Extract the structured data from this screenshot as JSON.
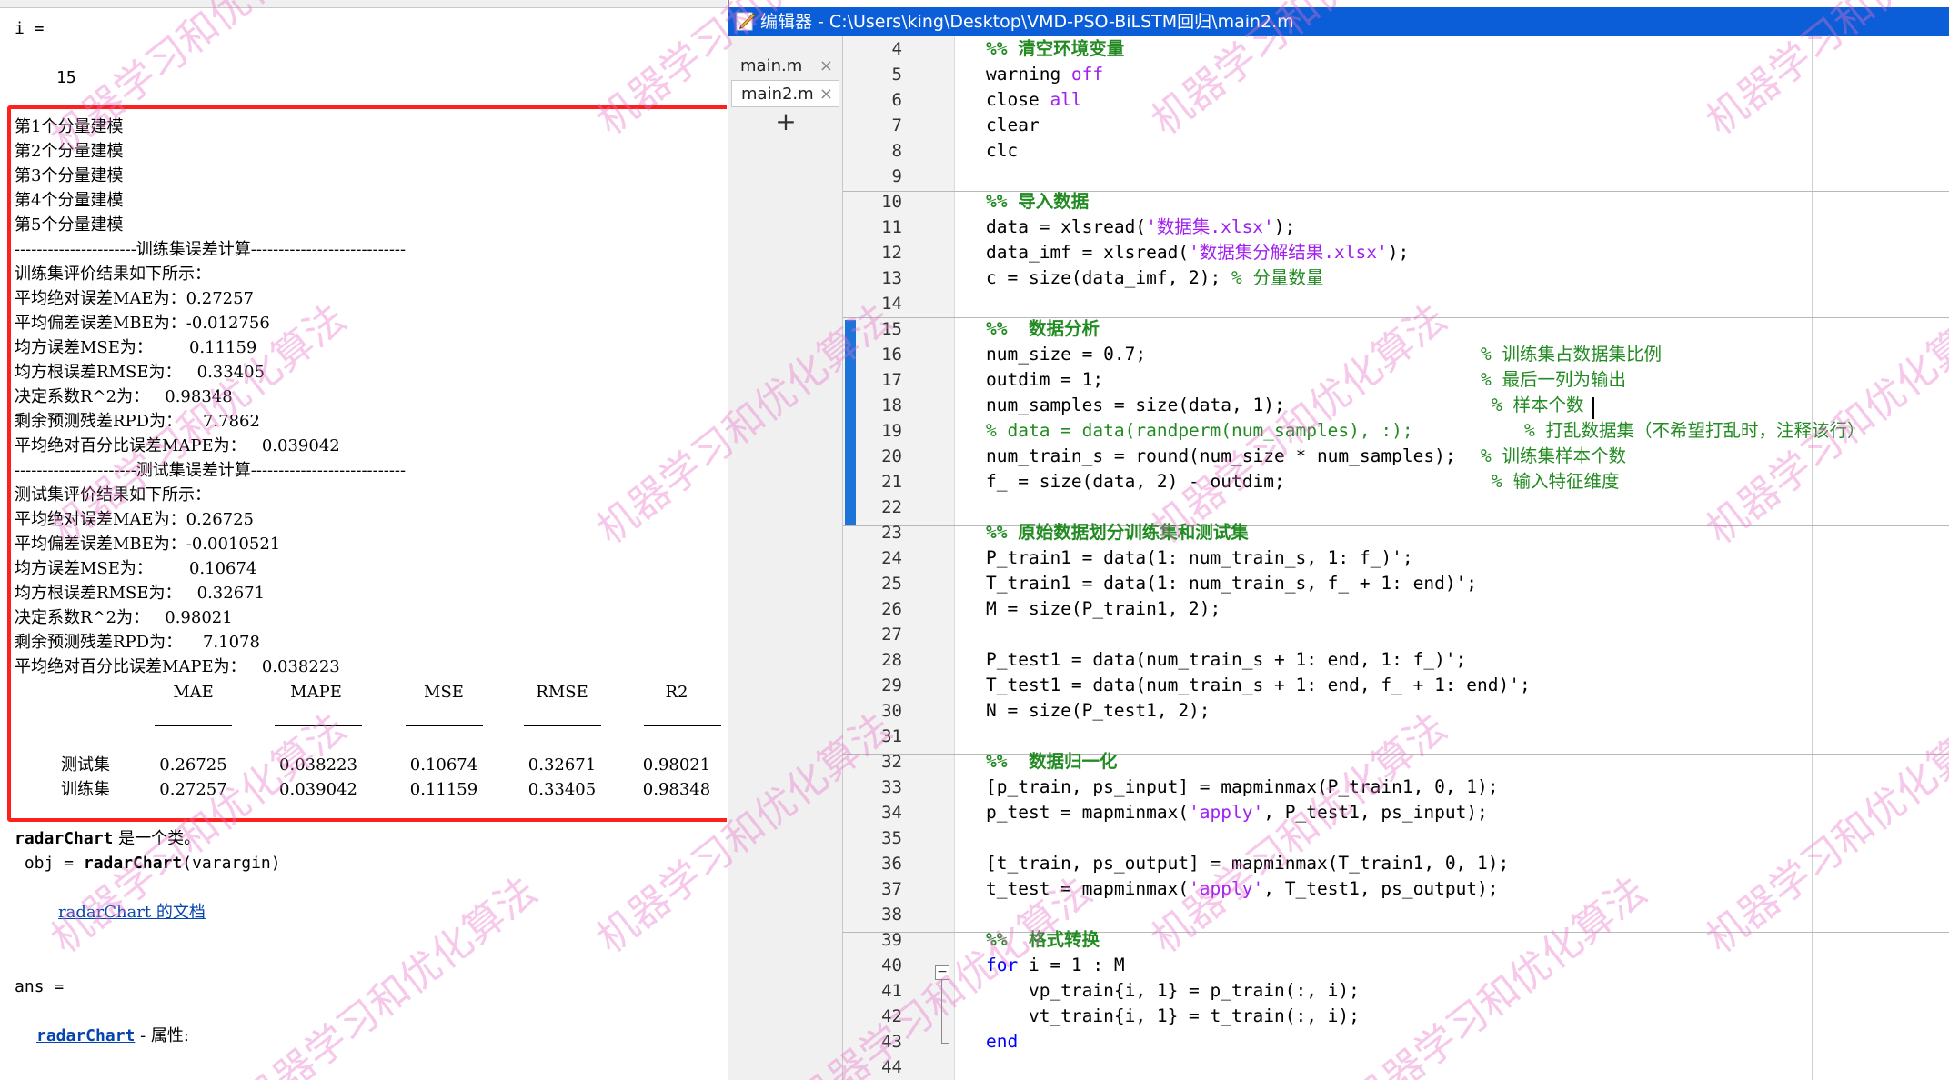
{
  "command_window": {
    "lines": {
      "i_eq": "i =",
      "i_val": "15",
      "model1": "第1个分量建模",
      "model2": "第2个分量建模",
      "model3": "第3个分量建模",
      "model4": "第4个分量建模",
      "model5": "第5个分量建模",
      "train_sep": "----------------------训练集误差计算----------------------------",
      "train_head": "训练集评价结果如下所示：",
      "train_mae": "平均绝对误差MAE为：0.27257",
      "train_mbe": "平均偏差误差MBE为：-0.012756",
      "train_mse": "均方误差MSE为：       0.11159",
      "train_rmse": "均方根误差RMSE为：   0.33405",
      "train_r2": "决定系数R^2为：   0.98348",
      "train_rpd": "剩余预测残差RPD为：    7.7862",
      "train_mape": "平均绝对百分比误差MAPE为：   0.039042",
      "test_sep": "----------------------测试集误差计算----------------------------",
      "test_head": "测试集评价结果如下所示：",
      "test_mae": "平均绝对误差MAE为：0.26725",
      "test_mbe": "平均偏差误差MBE为：-0.0010521",
      "test_mse": "均方误差MSE为：       0.10674",
      "test_rmse": "均方根误差RMSE为：   0.32671",
      "test_r2": "决定系数R^2为：   0.98021",
      "test_rpd": "剩余预测残差RPD为：    7.1078",
      "test_mape": "平均绝对百分比误差MAPE为：   0.038223",
      "radar_class_name": "radarChart",
      "radar_class_rest": " 是一个类。",
      "obj_pre": " obj = ",
      "obj_fn": "radarChart",
      "obj_post": "(varargin)",
      "doc_link": "radarChart 的文档",
      "ans_eq": "ans =",
      "ans_link": "radarChart",
      "ans_rest": " - 属性:"
    },
    "table": {
      "headers": [
        "MAE",
        "MAPE",
        "MSE",
        "RMSE",
        "R2"
      ],
      "rows": [
        {
          "label": "测试集",
          "values": [
            "0.26725",
            "0.038223",
            "0.10674",
            "0.32671",
            "0.98021"
          ]
        },
        {
          "label": "训练集",
          "values": [
            "0.27257",
            "0.039042",
            "0.11159",
            "0.33405",
            "0.98348"
          ]
        }
      ]
    }
  },
  "editor": {
    "title": "编辑器 - C:\\Users\\king\\Desktop\\VMD-PSO-BiLSTM回归\\main2.m",
    "tabs": [
      {
        "label": "main.m",
        "close": "×"
      },
      {
        "label": "main2.m",
        "close": "×"
      }
    ],
    "add_tab": "+",
    "fold_marker": "−",
    "line_numbers": [
      "4",
      "5",
      "6",
      "7",
      "8",
      "9",
      "10",
      "11",
      "12",
      "13",
      "14",
      "15",
      "16",
      "17",
      "18",
      "19",
      "20",
      "21",
      "22",
      "23",
      "24",
      "25",
      "26",
      "27",
      "28",
      "29",
      "30",
      "31",
      "32",
      "33",
      "34",
      "35",
      "36",
      "37",
      "38",
      "39",
      "40",
      "41",
      "42",
      "43",
      "44"
    ],
    "code": {
      "l4": "%% 清空环境变量",
      "l5a": "warning ",
      "l5b": "off",
      "l6a": "close ",
      "l6b": "all",
      "l7": "clear",
      "l8": "clc",
      "l10": "%% 导入数据",
      "l11a": "data = xlsread(",
      "l11b": "'数据集.xlsx'",
      "l11c": ");",
      "l12a": "data_imf = xlsread(",
      "l12b": "'数据集分解结果.xlsx'",
      "l12c": ");",
      "l13a": "c = size(data_imf, 2); ",
      "l13b": "% 分量数量",
      "l15": "%%  数据分析",
      "l16a": "num_size = 0.7;",
      "l16b": "% 训练集占数据集比例",
      "l17a": "outdim = 1;",
      "l17b": "% 最后一列为输出",
      "l18a": "num_samples = size(data, 1);",
      "l18b": "% 样本个数",
      "l19a": "% data = data(randperm(num_samples), :);",
      "l19b": "% 打乱数据集（不希望打乱时，注释该行）",
      "l20a": "num_train_s = round(num_size * num_samples);",
      "l20b": "% 训练集样本个数",
      "l21a": "f_ = size(data, 2) - outdim;",
      "l21b": "% 输入特征维度",
      "l23": "%% 原始数据划分训练集和测试集",
      "l24": "P_train1 = data(1: num_train_s, 1: f_)';",
      "l25": "T_train1 = data(1: num_train_s, f_ + 1: end)';",
      "l26": "M = size(P_train1, 2);",
      "l28": "P_test1 = data(num_train_s + 1: end, 1: f_)';",
      "l29": "T_test1 = data(num_train_s + 1: end, f_ + 1: end)';",
      "l30": "N = size(P_test1, 2);",
      "l32": "%%  数据归一化",
      "l33": "[p_train, ps_input] = mapminmax(P_train1, 0, 1);",
      "l34a": "p_test = mapminmax(",
      "l34b": "'apply'",
      "l34c": ", P_test1, ps_input);",
      "l36": "[t_train, ps_output] = mapminmax(T_train1, 0, 1);",
      "l37a": "t_test = mapminmax(",
      "l37b": "'apply'",
      "l37c": ", T_test1, ps_output);",
      "l39": "%%  格式转换",
      "l40a": "for",
      "l40b": " i = 1 : M",
      "l41": "    vp_train{i, 1} = p_train(:, i);",
      "l42": "    vt_train{i, 1} = t_train(:, i);",
      "l43": "end"
    }
  },
  "watermark": {
    "text": "机器学习和优化算法",
    "color": "#e86ec8"
  },
  "colors": {
    "titlebar": "#0b5ed7",
    "highlight_box": "#ff1f1f",
    "keyword": "#0000ff",
    "string": "#a020f0",
    "comment": "#228b22"
  }
}
